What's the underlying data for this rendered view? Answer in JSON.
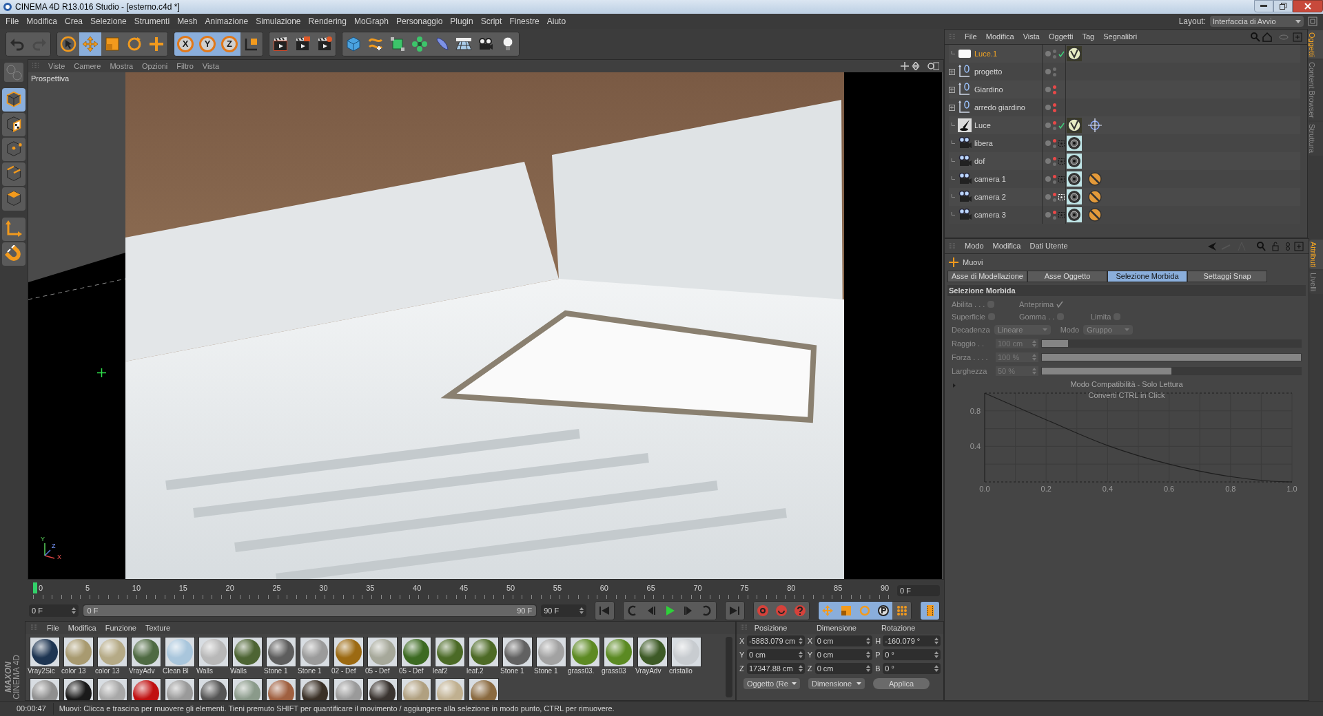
{
  "window": {
    "title": "CINEMA 4D R13.016 Studio - [esterno.c4d *]"
  },
  "menu": [
    "File",
    "Modifica",
    "Crea",
    "Selezione",
    "Strumenti",
    "Mesh",
    "Animazione",
    "Simulazione",
    "Rendering",
    "MoGraph",
    "Personaggio",
    "Plugin",
    "Script",
    "Finestre",
    "Aiuto"
  ],
  "layout": {
    "label": "Layout:",
    "value": "Interfaccia di Avvio"
  },
  "toolbar": {
    "tools": [
      {
        "kind": "live-select",
        "selected": false
      },
      {
        "kind": "move",
        "selected": true
      },
      {
        "kind": "scale",
        "selected": false
      },
      {
        "kind": "rotate",
        "selected": false
      },
      {
        "kind": "recent",
        "selected": false
      }
    ],
    "axis_locks": [
      {
        "label": "X",
        "on": true
      },
      {
        "label": "Y",
        "on": true
      },
      {
        "label": "Z",
        "on": true
      }
    ]
  },
  "modes": [
    {
      "kind": "model",
      "selected": true
    },
    {
      "kind": "texture",
      "selected": false
    },
    {
      "kind": "points",
      "selected": false
    },
    {
      "kind": "edges",
      "selected": false
    },
    {
      "kind": "polygons",
      "selected": false
    }
  ],
  "viewport": {
    "menu": [
      "Viste",
      "Camere",
      "Mostra",
      "Opzioni",
      "Filtro",
      "Vista"
    ],
    "camera_label": "Prospettiva",
    "axis_labels": [
      "Y",
      "Z",
      "X"
    ]
  },
  "timeline": {
    "ticks": [
      "0",
      "5",
      "10",
      "15",
      "20",
      "25",
      "30",
      "35",
      "40",
      "45",
      "50",
      "55",
      "60",
      "65",
      "70",
      "75",
      "80",
      "85",
      "90"
    ],
    "level": 0,
    "current_frame": "0 F"
  },
  "playback": {
    "start": "0 F",
    "range_start": "0 F",
    "range_end": "90 F",
    "end": "90 F",
    "level": 1
  },
  "materials": {
    "menu": [
      "File",
      "Modifica",
      "Funzione",
      "Texture"
    ],
    "logo": [
      "MAXON",
      "CINEMA 4D"
    ],
    "items": [
      {
        "name": "Vray2Sic",
        "color": "#1e3552"
      },
      {
        "name": "color 13",
        "color": "#a89a70"
      },
      {
        "name": "color 13",
        "color": "#b5aa86"
      },
      {
        "name": "VrayAdv",
        "color": "#4f6a43"
      },
      {
        "name": "Clean Bl",
        "color": "#a9c6dc"
      },
      {
        "name": "Walls",
        "color": "#b8b8b8"
      },
      {
        "name": "Walls",
        "color": "#4d6433"
      },
      {
        "name": "Stone 1",
        "color": "#5d5d5d"
      },
      {
        "name": "Stone 1",
        "color": "#9b9b9b"
      },
      {
        "name": "02 - Def",
        "color": "#9c6a12"
      },
      {
        "name": "05 - Def",
        "color": "#a6a89a"
      },
      {
        "name": "05 - Def",
        "color": "#3c6a22"
      },
      {
        "name": "leaf2",
        "color": "#4b6a26"
      },
      {
        "name": "leaf.2",
        "color": "#4d6a26"
      },
      {
        "name": "Stone 1",
        "color": "#616161"
      },
      {
        "name": "Stone 1",
        "color": "#a2a2a2"
      },
      {
        "name": "grass03.",
        "color": "#5d8a23"
      },
      {
        "name": "grass03",
        "color": "#5b8a22"
      },
      {
        "name": "VrayAdv",
        "color": "#3d5a26"
      },
      {
        "name": "cristallo",
        "color": "#c8ccd0"
      }
    ],
    "more": [
      {
        "color": "#8f8f8f"
      },
      {
        "color": "#1a1a1a"
      },
      {
        "color": "#a8a8a8"
      },
      {
        "color": "#c01010"
      },
      {
        "color": "#9a9a9a"
      },
      {
        "color": "#555555"
      },
      {
        "color": "#8a9a8a"
      },
      {
        "color": "#a06040"
      },
      {
        "color": "#3a3026"
      },
      {
        "color": "#9a9a9a"
      },
      {
        "color": "#3a3430"
      },
      {
        "color": "#b0a080"
      },
      {
        "color": "#c0b090"
      },
      {
        "color": "#8a6a40"
      }
    ]
  },
  "coordinates": {
    "headers": [
      "Posizione",
      "Dimensione",
      "Rotazione"
    ],
    "rows": [
      {
        "axis": "X",
        "position": "-5883.079 cm",
        "size_axis": "X",
        "size": "0 cm",
        "rot_axis": "H",
        "rotation": "-160.079 °"
      },
      {
        "axis": "Y",
        "position": "0 cm",
        "size_axis": "Y",
        "size": "0 cm",
        "rot_axis": "P",
        "rotation": "0 °"
      },
      {
        "axis": "Z",
        "position": "17347.88 cm",
        "size_axis": "Z",
        "size": "0 cm",
        "rot_axis": "B",
        "rotation": "0 °"
      }
    ],
    "buttons": [
      {
        "label": "Oggetto (Re",
        "kind": "dropdown"
      },
      {
        "label": "Dimensione",
        "kind": "dropdown"
      },
      {
        "label": "Applica",
        "kind": "button"
      }
    ]
  },
  "objects": {
    "menu": [
      "File",
      "Modifica",
      "Vista",
      "Oggetti",
      "Tag",
      "Segnalibri"
    ],
    "items": [
      {
        "name": "Luce.1",
        "kind": "area-light",
        "selected": true,
        "expandable": false,
        "editor_hidden": false,
        "render_hidden": false,
        "enabled": true,
        "tags": [
          {
            "kind": "vray"
          }
        ]
      },
      {
        "name": "progetto",
        "kind": "null",
        "selected": false,
        "expandable": true,
        "editor_hidden": false,
        "render_hidden": false,
        "enabled": false
      },
      {
        "name": "Giardino",
        "kind": "null",
        "selected": false,
        "expandable": true,
        "editor_hidden": true,
        "render_hidden": true,
        "enabled": false
      },
      {
        "name": "arredo giardino",
        "kind": "null",
        "selected": false,
        "expandable": true,
        "editor_hidden": true,
        "render_hidden": true,
        "enabled": false
      },
      {
        "name": "Luce",
        "kind": "light",
        "selected": false,
        "expandable": false,
        "editor_hidden": true,
        "render_hidden": false,
        "enabled": true,
        "tags": [
          {
            "kind": "vray"
          },
          {
            "kind": "target"
          }
        ]
      },
      {
        "name": "libera",
        "kind": "camera",
        "selected": false,
        "expandable": false,
        "editor_hidden": true,
        "render_hidden": false,
        "enabled": false,
        "active": false,
        "tags": [
          {
            "kind": "camera"
          }
        ]
      },
      {
        "name": "dof",
        "kind": "camera",
        "selected": false,
        "expandable": false,
        "editor_hidden": true,
        "render_hidden": false,
        "enabled": false,
        "active": false,
        "tags": [
          {
            "kind": "camera"
          }
        ]
      },
      {
        "name": "camera 1",
        "kind": "camera",
        "selected": false,
        "expandable": false,
        "editor_hidden": true,
        "render_hidden": false,
        "enabled": false,
        "active": false,
        "tags": [
          {
            "kind": "camera"
          },
          {
            "kind": "protection"
          }
        ]
      },
      {
        "name": "camera 2",
        "kind": "camera",
        "selected": false,
        "expandable": false,
        "editor_hidden": true,
        "render_hidden": false,
        "enabled": false,
        "active": true,
        "tags": [
          {
            "kind": "camera"
          },
          {
            "kind": "protection"
          }
        ]
      },
      {
        "name": "camera 3",
        "kind": "camera",
        "selected": false,
        "expandable": false,
        "editor_hidden": true,
        "render_hidden": false,
        "enabled": false,
        "active": false,
        "tags": [
          {
            "kind": "camera"
          },
          {
            "kind": "protection"
          }
        ]
      }
    ]
  },
  "side_tabs_top": [
    {
      "label": "Oggetti",
      "selected": true
    },
    {
      "label": "Content Browser",
      "selected": false
    },
    {
      "label": "Struttura",
      "selected": false
    }
  ],
  "attributes": {
    "menu": [
      "Modo",
      "Modifica",
      "Dati Utente"
    ],
    "tool": "Muovi",
    "tabs": [
      {
        "label": "Asse di Modellazione",
        "selected": false
      },
      {
        "label": "Asse Oggetto",
        "selected": false
      },
      {
        "label": "Selezione Morbida",
        "selected": true
      },
      {
        "label": "Settaggi Snap",
        "selected": false
      }
    ],
    "section": "Selezione Morbida",
    "disabled": true,
    "check_rows": [
      [
        {
          "label": "Abilita . . .",
          "checked": false
        },
        {
          "label": "Anteprima",
          "checked": true
        }
      ],
      [
        {
          "label": "Superficie",
          "checked": false
        },
        {
          "label": "Gomma . .",
          "checked": false
        },
        {
          "label": "Limita",
          "checked": false
        }
      ]
    ],
    "dropdowns": [
      {
        "label": "Decadenza",
        "value": "Lineare"
      },
      {
        "label": "Modo",
        "value": "Gruppo"
      }
    ],
    "sliders": [
      {
        "label": "Raggio . .",
        "value": "100 cm",
        "level": 0.1
      },
      {
        "label": "Forza . . . .",
        "value": "100 %",
        "level": 1
      },
      {
        "label": "Larghezza",
        "value": "50 %",
        "level": 0.5
      }
    ],
    "chart_notice": [
      "Modo Compatibilità - Solo Lettura",
      "Converti CTRL in Click"
    ],
    "chart_data": {
      "type": "line",
      "x": [
        0,
        0.2,
        0.4,
        0.6,
        0.8,
        1.0
      ],
      "series": [
        {
          "color": "#1e1e1e",
          "values": [
            1,
            0.7,
            0.41,
            0.2,
            0.06,
            0
          ]
        }
      ],
      "xlim": [
        0,
        1
      ],
      "ylim": [
        0,
        1
      ],
      "grid": true,
      "xticks": [
        {
          "value": 0,
          "label": "0.0"
        },
        {
          "value": 0.2,
          "label": "0.2"
        },
        {
          "value": 0.4,
          "label": "0.4"
        },
        {
          "value": 0.6,
          "label": "0.6"
        },
        {
          "value": 0.8,
          "label": "0.8"
        },
        {
          "value": 1,
          "label": "1.0"
        }
      ],
      "yticks": [
        {
          "value": 0.4,
          "label": "0.4"
        },
        {
          "value": 0.8,
          "label": "0.8"
        }
      ]
    }
  },
  "side_tabs_bottom": [
    {
      "label": "Attributi",
      "selected": true
    },
    {
      "label": "Livelli",
      "selected": false
    }
  ],
  "status_bar": {
    "time": "00:00:47",
    "message": "Muovi: Clicca e trascina per muovere gli elementi. Tieni premuto SHIFT per quantificare il movimento / aggiungere alla selezione in modo punto, CTRL per rimuovere."
  }
}
